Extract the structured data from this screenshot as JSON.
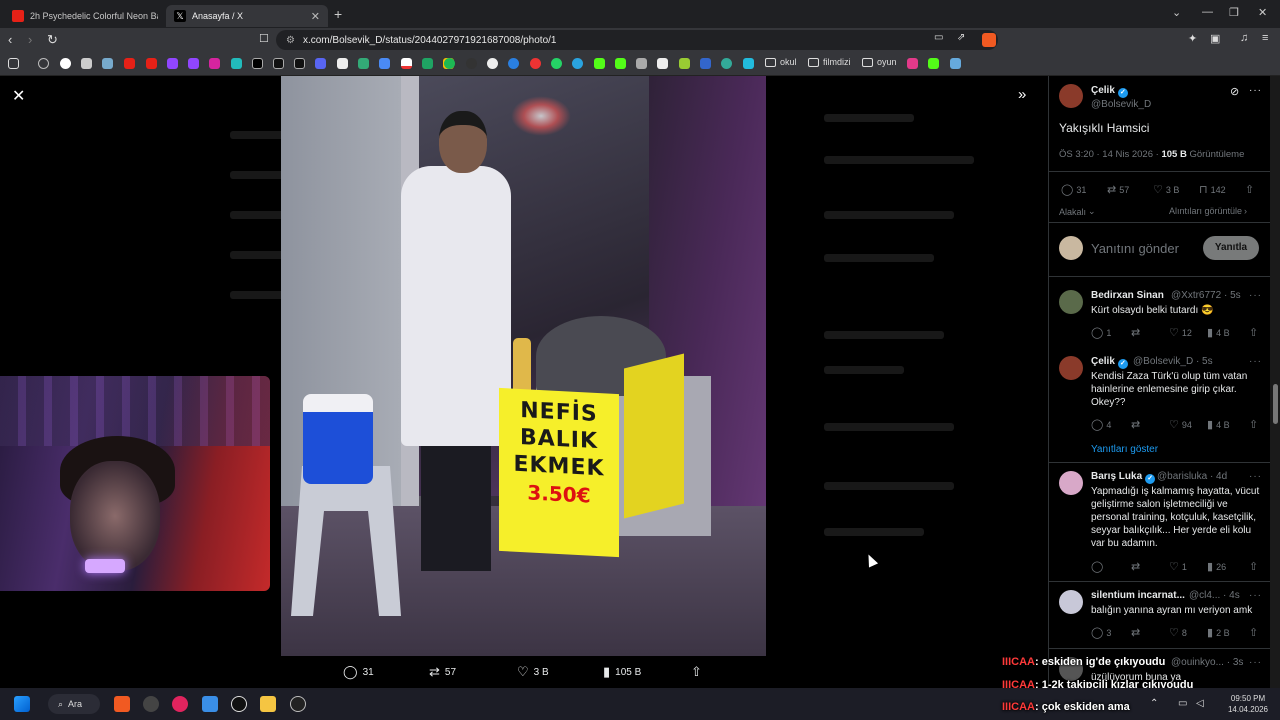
{
  "tabs": [
    {
      "label": "2h Psychedelic Colorful Neon Backgro",
      "favicon_color": "#e62117"
    },
    {
      "label": "Anasayfa / X",
      "favicon_color": "#ffffff"
    }
  ],
  "address": {
    "url": "x.com/Bolsevik_D/status/2044027971921687008/photo/1"
  },
  "bookmarks": {
    "folders": [
      "okul",
      "filmdizi",
      "oyun"
    ]
  },
  "photo_actions": {
    "replies": "31",
    "reposts": "57",
    "likes": "3 B",
    "views": "105 B"
  },
  "panel": {
    "author": {
      "name": "Çelik",
      "handle": "@Bolsevik_D"
    },
    "tweet_text": "Yakışıklı Hamsici",
    "meta_time": "ÖS 3:20 · 14 Nis 2026 · ",
    "meta_views": "105 B",
    "meta_views_label": " Görüntüleme",
    "stats": {
      "replies": "31",
      "reposts": "57",
      "likes": "3 B",
      "bookmarks": "142"
    },
    "sort_label": "Alakalı",
    "quotes_label": "Alıntıları görüntüle",
    "reply_placeholder": "Yanıtını gönder",
    "reply_button": "Yanıtla",
    "replies": [
      {
        "name": "Bedirxan Sinan",
        "handle": "@Xxtr6772 · 5s",
        "text": "Kürt olsaydı belki tutardı 😎",
        "stats": [
          "1",
          "",
          "12",
          "4 B"
        ],
        "avatar_color": "#5a6a4a"
      },
      {
        "name": "Çelik",
        "handle": "@Bolsevik_D · 5s",
        "text": "Kendisi Zaza Türk'ü olup tüm vatan hainlerine enlemesine girip çıkar. Okey??",
        "stats": [
          "4",
          "",
          "94",
          "4 B"
        ],
        "avatar_color": "#8a3a2a",
        "show_replies": "Yanıtları göster"
      },
      {
        "name": "Barış Luka",
        "handle": "@barisluka · 4d",
        "text": "Yapmadığı iş kalmamış hayatta, vücut geliştirme salon işletmeciliği ve personal training, kotçuluk, kasetçilik, seyyar balıkçılık... Her yerde eli kolu var bu adamın.",
        "stats": [
          "",
          "",
          "1",
          "26"
        ],
        "avatar_color": "#d8a8c8"
      },
      {
        "name": "silentium incarnat...",
        "handle": "@cl4... · 4s",
        "text": "balığın yanına ayran mı veriyon amk",
        "stats": [
          "3",
          "",
          "8",
          "2 B"
        ],
        "avatar_color": "#c8c8d8"
      },
      {
        "name": "",
        "handle": "@ouinkyo... · 3s",
        "text": "üzülüyorum buna ya",
        "stats": [],
        "avatar_color": "#555"
      }
    ]
  },
  "chat": [
    {
      "user": "IIICAA",
      "message": ": eskiden ig'de çıkıyoudu"
    },
    {
      "user": "IIICAA",
      "message": ": 1-2k takipçili kızlar çıkıyoudu"
    },
    {
      "user": "IIICAA",
      "message": ": çok eskiden ama"
    }
  ],
  "photo_sign": {
    "line1": "NEFİS",
    "line2": "BALIK",
    "line3": "EKMEK",
    "price": "3.50€"
  },
  "taskbar": {
    "search_label": "Ara",
    "time": "09:50 PM",
    "date": "14.04.2026"
  },
  "colors": {
    "accent_blue": "#1d9bf0",
    "chat_user": "#ff3a3a"
  }
}
